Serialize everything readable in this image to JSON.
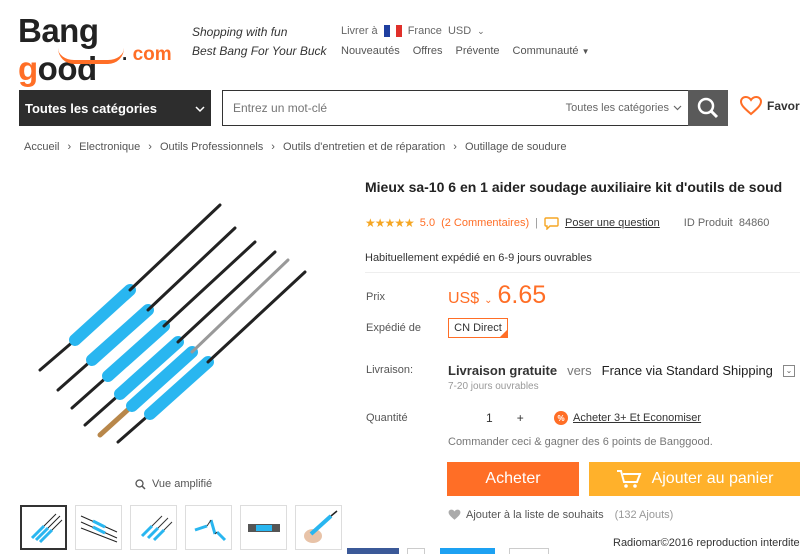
{
  "logo": {
    "part1": "Bang",
    "part2": "ood",
    "g": "g",
    "domain": "com",
    "dot": "."
  },
  "tagline": {
    "line1": "Shopping with fun",
    "line2": "Best Bang For Your Buck"
  },
  "topnav": {
    "deliver_label": "Livrer à",
    "country": "France",
    "currency": "USD"
  },
  "subnav": [
    {
      "label": "Nouveautés"
    },
    {
      "label": "Offres"
    },
    {
      "label": "Prévente"
    },
    {
      "label": "Communauté"
    }
  ],
  "search": {
    "category_button": "Toutes les catégories",
    "placeholder": "Entrez un mot-clé",
    "scope": "Toutes les catégories"
  },
  "favorites_label": "Favori",
  "breadcrumb": [
    "Accueil",
    "Electronique",
    "Outils Professionnels",
    "Outils d'entretien et de réparation",
    "Outillage de soudure"
  ],
  "product": {
    "title": "Mieux sa-10 6 en 1 aider soudage auxiliaire kit d'outils de soud",
    "rating": "5.0",
    "reviews": "(2 Commentaires)",
    "ask": "Poser une question",
    "id_label": "ID Produit",
    "id_value": "84860",
    "ship_time": "Habituellement expédié en 6-9 jours ouvrables",
    "price_label": "Prix",
    "currency": "US$",
    "price": "6.65",
    "warehouse_label": "Expédié de",
    "warehouse": "CN Direct",
    "delivery_label": "Livraison:",
    "delivery_free": "Livraison gratuite",
    "delivery_vers": "vers",
    "delivery_via": "France via Standard Shipping",
    "delivery_days": "7-20 jours ouvrables",
    "qty_label": "Quantité",
    "qty_value": "1",
    "qty_plus": "+",
    "bulk": "Acheter 3+ Et Economiser",
    "points": "Commander ceci & gagner des 6 points de Banggood.",
    "buy": "Acheter",
    "cart": "Ajouter au panier",
    "wishlist": "Ajouter à la liste de souhaits",
    "wishlist_count": "(132 Ajouts)"
  },
  "gallery": {
    "zoom_label": "Vue amplifié",
    "thumb_count": 6
  },
  "watermark": "Radiomar©2016 reproduction interdite",
  "colors": {
    "accent": "#ff6e26",
    "cart": "#ffb12b",
    "star": "#f5a623",
    "dark": "#2d2d2d"
  }
}
